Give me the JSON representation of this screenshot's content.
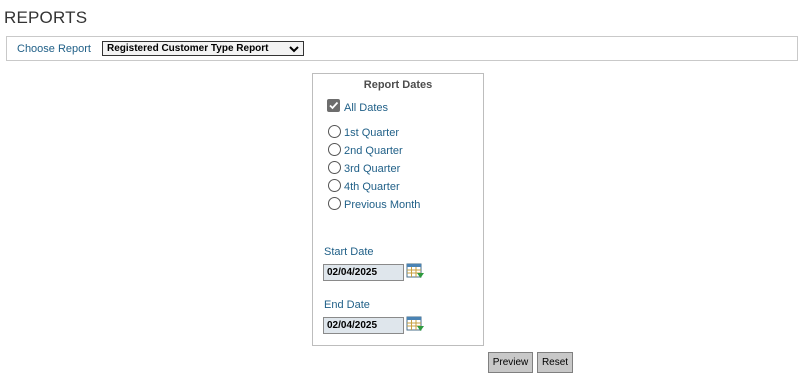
{
  "page": {
    "title": "REPORTS"
  },
  "choose": {
    "label": "Choose Report",
    "selected": "Registered Customer Type Report"
  },
  "dates": {
    "title": "Report Dates",
    "all_dates": {
      "label": "All Dates",
      "checked": true
    },
    "options": [
      {
        "label": "1st Quarter"
      },
      {
        "label": "2nd Quarter"
      },
      {
        "label": "3rd Quarter"
      },
      {
        "label": "4th Quarter"
      },
      {
        "label": "Previous Month"
      }
    ],
    "start": {
      "label": "Start Date",
      "value": "02/04/2025"
    },
    "end": {
      "label": "End Date",
      "value": "02/04/2025"
    }
  },
  "buttons": {
    "preview": "Preview",
    "reset": "Reset"
  },
  "colors": {
    "link_text": "#1f5f87",
    "button_bg": "#c8c8c8",
    "input_bg": "#dfe6ec",
    "checkbox": "#6d6d6d"
  }
}
